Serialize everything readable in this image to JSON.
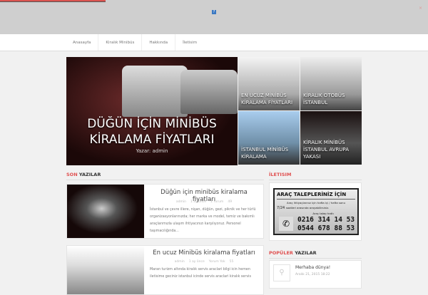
{
  "nav": {
    "items": [
      "Anasayfa",
      "Kiralık Minibüs",
      "Hakkında",
      "İletisim"
    ]
  },
  "topbar": {
    "help_icon": "?",
    "close_icon": "×"
  },
  "slider": {
    "main": {
      "title": "DÜĞÜN İÇİN MİNİBÜS KİRALAMA FİYATLARI",
      "author": "Yazar: admin"
    },
    "tiles": [
      "EN UCUZ MİNİBÜS KİRALAMA FİYATLARI",
      "KİRALIK OTOBÜS İSTANBUL",
      "İSTANBUL MİNİBÜS KİRALAMA",
      "KİRALIK MİNİBÜS İSTANBUL AVRUPA YAKASI"
    ]
  },
  "recent": {
    "title_a": "SON",
    "title_b": "YAZILAR",
    "posts": [
      {
        "title": "Düğün için minibüs kiralama fiyatları",
        "author": "admin",
        "date": "1 ay önce",
        "comments": "1 Yorum",
        "views": "49",
        "excerpt": "İstanbul ve çevre illere, nişan, düğün, gezi, piknik ve her türlü organizasyonlarınızda; her marka ve model, temiz ve bakımlı araçlarımızla ulaşım ihtiyacınızı karşılıyoruz. Personel taşımacılığında..."
      },
      {
        "title": "En ucuz Minibüs kiralama fiyatları",
        "author": "admin",
        "date": "1 ay önce",
        "comments": "Yorum Yok",
        "views": "55",
        "excerpt": "Maran turizm altında kiralık servis araclari bilgi icin hemen iletisime geciniz istanbul icinde servis araclari kiralık servis"
      }
    ]
  },
  "contact": {
    "title": "İLETISIM",
    "ad_heading": "ARAÇ TALEPLERİNİZ İÇİN",
    "ad_line": "Araç ihtiyaçlarınız için hafta içi / hafta sonu",
    "ad_hours": "7/24",
    "ad_line2": "saatleri arasında arayabilirsiniz.",
    "ad_label": "Araç talep hattı",
    "phone1": "0216 314 14 53",
    "phone2": "0544 678 88 53"
  },
  "popular": {
    "title_a": "POPÜLER",
    "title_b": "YAZILAR",
    "posts": [
      {
        "title": "Merhaba dünya!",
        "date": "Aralık 21, 2015 18:22"
      }
    ]
  }
}
